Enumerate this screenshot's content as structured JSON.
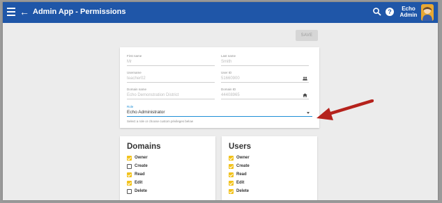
{
  "appbar": {
    "title": "Admin App - Permissions",
    "user_line1": "Echo",
    "user_line2": "Admin",
    "menu_icon": "hamburger-menu-icon",
    "back_icon": "arrow-back-icon",
    "search_icon": "search-icon",
    "help_icon": "help-icon",
    "help_glyph": "?",
    "color": "#1f56a8"
  },
  "toolbar": {
    "save_label": "SAVE"
  },
  "profile": {
    "first_name": {
      "label": "First name",
      "value": "Mr"
    },
    "last_name": {
      "label": "Last name",
      "value": "Smith"
    },
    "username": {
      "label": "Username",
      "value": "teacher02"
    },
    "user_id": {
      "label": "User ID",
      "value": "51660900",
      "icon": "people-icon"
    },
    "domain_name": {
      "label": "Domain name",
      "value": "Echo Demonstration District"
    },
    "domain_id": {
      "label": "Domain ID",
      "value": "44408965",
      "icon": "home-icon"
    },
    "role": {
      "label": "Role",
      "value": "Echo Administrator",
      "helper": "Select a role or choose custom privileges below",
      "accent": "#1f8fd6"
    }
  },
  "domains": {
    "title": "Domains",
    "items": [
      {
        "label": "Owner",
        "checked": true
      },
      {
        "label": "Create",
        "checked": false
      },
      {
        "label": "Read",
        "checked": true
      },
      {
        "label": "Edit",
        "checked": true
      },
      {
        "label": "Delete",
        "checked": false
      }
    ]
  },
  "users": {
    "title": "Users",
    "items": [
      {
        "label": "Owner",
        "checked": true
      },
      {
        "label": "Create",
        "checked": true
      },
      {
        "label": "Read",
        "checked": true
      },
      {
        "label": "Edit",
        "checked": true
      },
      {
        "label": "Delete",
        "checked": true
      }
    ]
  },
  "colors": {
    "checkbox_checked": "#f2c21b",
    "annotation_arrow": "#b5221c"
  }
}
